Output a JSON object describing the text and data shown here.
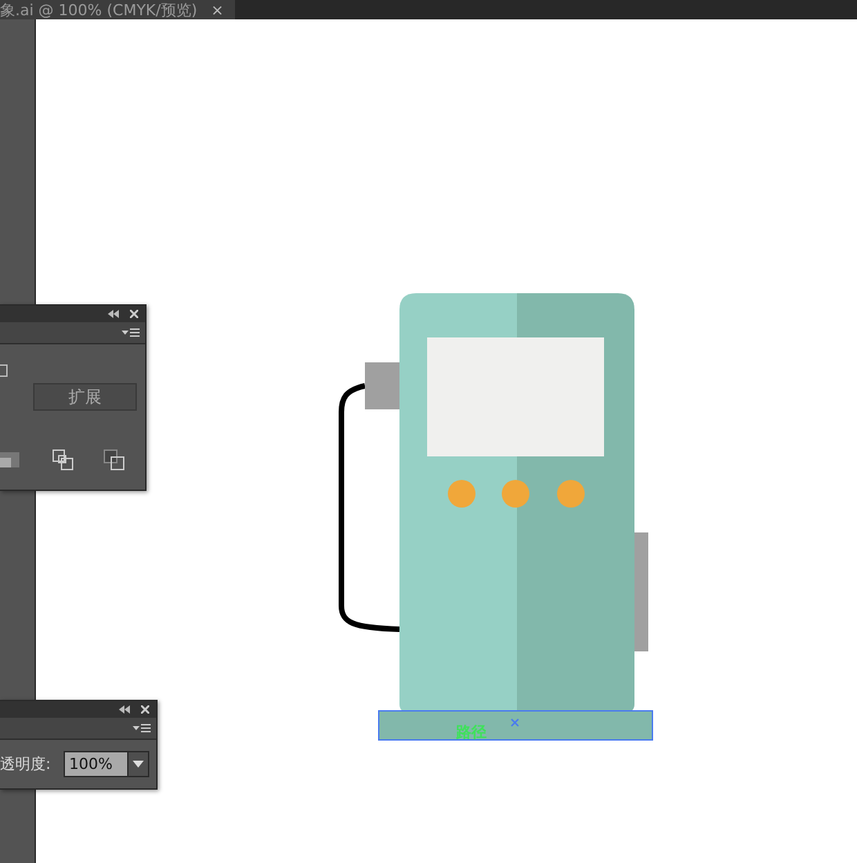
{
  "document_tab": {
    "title": "象.ai  @ 100% (CMYK/预览)",
    "close": "×"
  },
  "pathfinder_panel": {
    "expand_button": "扩展"
  },
  "transparency_panel": {
    "opacity_label": "透明度:",
    "opacity_value": "100%"
  },
  "canvas": {
    "selection_label": "路径"
  }
}
